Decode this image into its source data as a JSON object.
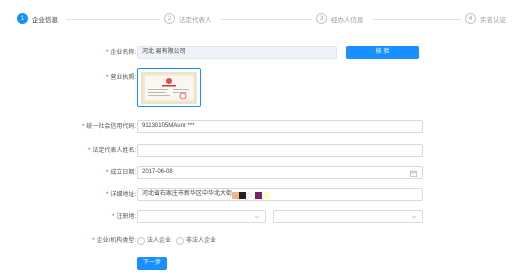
{
  "steps": [
    {
      "number": "1",
      "label": "企业信息",
      "active": true
    },
    {
      "number": "2",
      "label": "法定代表人",
      "active": false
    },
    {
      "number": "3",
      "label": "经办人信息",
      "active": false
    },
    {
      "number": "4",
      "label": "实名认证",
      "active": false
    }
  ],
  "form": {
    "company_name": {
      "label": "企业名称:",
      "value": "河北        易有限公司",
      "button": "核 验"
    },
    "license": {
      "label": "营业执照:"
    },
    "credit_code": {
      "label": "统一社会信用代码:",
      "value": "91130105MAunr     ***"
    },
    "legal_rep": {
      "label": "法定代表人姓名:",
      "value": "                    "
    },
    "established": {
      "label": "成立日期:",
      "value": "2017-06-08"
    },
    "address": {
      "label": "详细地址:",
      "value": "河北省石家庄市新华区中华北大街"
    },
    "registration": {
      "label": "注册地:",
      "value": ""
    },
    "org_type": {
      "label": "企业/机构类型:",
      "options": [
        "法人企业",
        "非法人企业"
      ]
    },
    "next_button": "下一步"
  },
  "colors": {
    "accent": "#1890ff",
    "required": "#f5222d"
  }
}
